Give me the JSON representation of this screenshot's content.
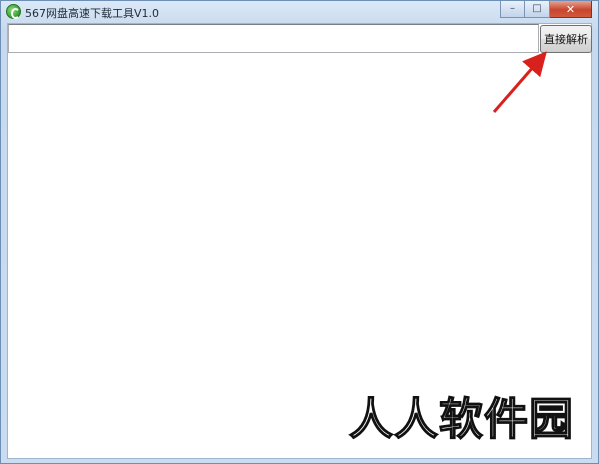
{
  "window": {
    "title": "567网盘高速下载工具V1.0",
    "controls": {
      "minimize_glyph": "–",
      "maximize_glyph": "□",
      "close_glyph": "✕"
    }
  },
  "main": {
    "url_input": {
      "value": "",
      "placeholder": ""
    },
    "parse_button_label": "直接解析"
  },
  "annotation": {
    "arrow_color": "#d8201c"
  },
  "watermark": {
    "text": "人人软件园"
  },
  "icons": [
    "app-logo-icon",
    "minimize-icon",
    "maximize-icon",
    "close-icon",
    "annotation-arrow"
  ]
}
